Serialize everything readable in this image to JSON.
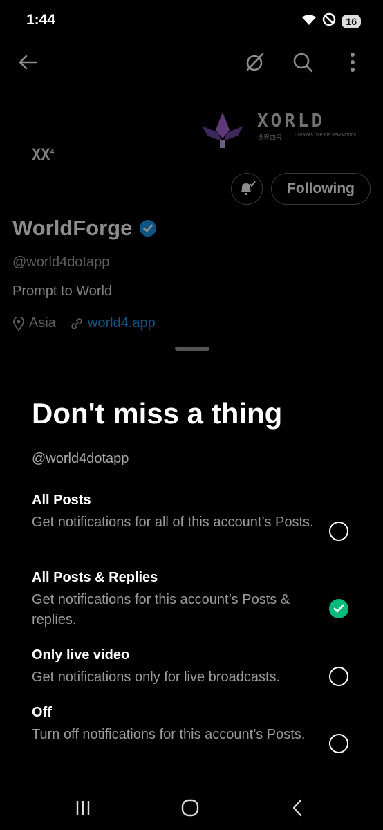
{
  "status_bar": {
    "time": "1:44",
    "battery": "16",
    "icons": [
      "wifi-icon",
      "do-not-disturb-icon",
      "battery-icon"
    ]
  },
  "profile": {
    "banner_wordmark": "XORLD",
    "banner_subtitle": "世界四号",
    "banner_tagline": "Creators rule the new worlds",
    "avatar_text": "XX",
    "avatar_superscript": "4",
    "following_label": "Following",
    "display_name": "WorldForge",
    "handle": "@world4dotapp",
    "bio": "Prompt to World",
    "location": "Asia",
    "website": "world4.app"
  },
  "sheet": {
    "title": "Don't miss a thing",
    "handle": "@world4dotapp",
    "options": [
      {
        "title": "All Posts",
        "description": "Get notifications for all of this account’s Posts.",
        "selected": false
      },
      {
        "title": "All Posts & Replies",
        "description": "Get notifications for this account’s Posts & replies.",
        "selected": true
      },
      {
        "title": "Only live video",
        "description": "Get notifications only for live broadcasts.",
        "selected": false
      },
      {
        "title": "Off",
        "description": "Turn off notifications for this account’s Posts.",
        "selected": false
      }
    ]
  },
  "colors": {
    "accent_link": "#1d9bf0",
    "selected_green": "#00ba7c",
    "verified_blue": "#1d9bf0"
  }
}
